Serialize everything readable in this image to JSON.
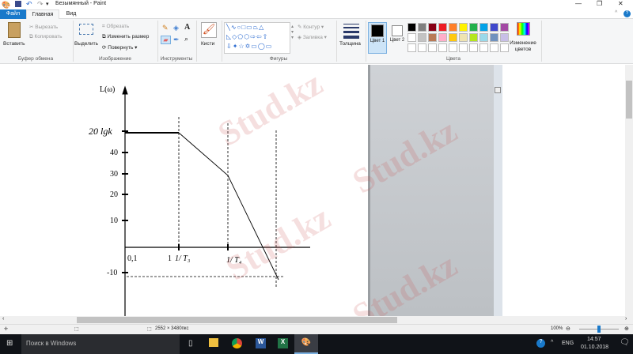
{
  "window": {
    "title": "Безымянный - Paint"
  },
  "tabs": [
    {
      "label": "Файл"
    },
    {
      "label": "Главная"
    },
    {
      "label": "Вид"
    }
  ],
  "ribbon": {
    "clipboard": {
      "paste": "Вставить",
      "cut": "Вырезать",
      "copy": "Копировать",
      "group": "Буфер обмена"
    },
    "image": {
      "select": "Выделить",
      "crop": "Обрезать",
      "resize": "Изменить размер",
      "rotate": "Повернуть",
      "group": "Изображение"
    },
    "tools": {
      "group": "Инструменты"
    },
    "brushes": {
      "label": "Кисти"
    },
    "shapes": {
      "outline": "Контур",
      "fill": "Заливка",
      "group": "Фигуры"
    },
    "size": {
      "label": "Толщина"
    },
    "colors": {
      "color1": "Цвет 1",
      "color2": "Цвет 2",
      "edit": "Изменение цветов",
      "group": "Цвета",
      "palette": [
        "#000000",
        "#7f7f7f",
        "#880015",
        "#ed1c24",
        "#ff7f27",
        "#fff200",
        "#22b14c",
        "#00a2e8",
        "#3f48cc",
        "#a349a4",
        "#ffffff",
        "#c3c3c3",
        "#b97a57",
        "#ffaec9",
        "#ffc90e",
        "#efe4b0",
        "#b5e61d",
        "#99d9ea",
        "#7092be",
        "#c8bfe7"
      ]
    }
  },
  "graph": {
    "ylabel": "L(ω)",
    "y_ticks": [
      "20 lgk",
      "40",
      "30",
      "20",
      "10",
      "-10"
    ],
    "x_labels": [
      "0,1",
      "1",
      "1/ T₃",
      "1/ T₄"
    ]
  },
  "watermark": "Stud.kz",
  "status": {
    "dimensions": "2552 × 3480пкс",
    "zoom": "100%"
  },
  "taskbar": {
    "search": "Поиск в Windows",
    "lang": "ENG",
    "time": "14:57",
    "date": "01.10.2018"
  }
}
